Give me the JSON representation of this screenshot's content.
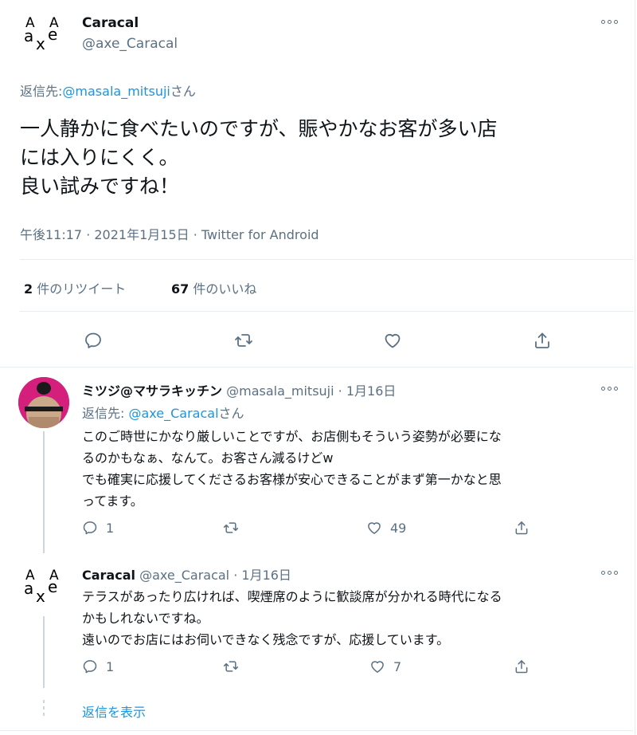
{
  "main_tweet": {
    "name": "Caracal",
    "handle": "@axe_Caracal",
    "reply_prefix": "返信先:",
    "reply_handle": "@masala_mitsuji",
    "reply_suffix": "さん",
    "text_line1": "一人静かに食べたいのですが、賑やかなお客が多い店",
    "text_line2": "には入りにくく。",
    "text_line3": "良い試みですね！",
    "timestamp": "午後11:17 · 2021年1月15日 · Twitter for Android",
    "retweet_count": "2",
    "retweet_label": "件のリツイート",
    "like_count": "67",
    "like_label": "件のいいね"
  },
  "reply1": {
    "name": "ミツジ@マサラキッチン",
    "handle": "@masala_mitsuji",
    "date": "· 1月16日",
    "reply_prefix": "返信先:",
    "reply_handle": "@axe_Caracal",
    "reply_suffix": "さん",
    "line1": "このご時世にかなり厳しいことですが、お店側もそういう姿勢が必要にな",
    "line2": "るのかもなぁ、なんて。お客さん減るけどw",
    "line3": "でも確実に応援してくださるお客様が安心できることがまず第一かなと思",
    "line4": "ってます。",
    "reply_count": "1",
    "like_count": "49"
  },
  "reply2": {
    "name": "Caracal",
    "handle": "@axe_Caracal",
    "date": "· 1月16日",
    "line1": "テラスがあったり広ければ、喫煙席のように歓談席が分かれる時代になる",
    "line2": "かもしれないですね。",
    "line3": "遠いのでお店にはお伺いできなく残念ですが、応援しています。",
    "reply_count": "1",
    "like_count": "7"
  },
  "show_replies": "返信を表示",
  "avatar_text": {
    "a1": "A",
    "a2": "A",
    "a": "a",
    "x": "x",
    "e": "e"
  },
  "colors": {
    "link": "#1b95e0",
    "gray": "#5b7083",
    "border": "#e6ecf0"
  }
}
